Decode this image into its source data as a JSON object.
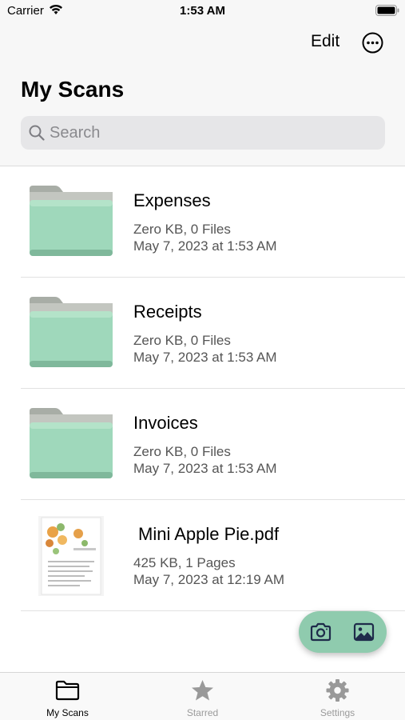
{
  "status_bar": {
    "carrier": "Carrier",
    "time": "1:53 AM"
  },
  "header": {
    "edit_label": "Edit",
    "more_icon": "ellipsis-circle-icon",
    "title": "My Scans"
  },
  "search": {
    "placeholder": "Search",
    "value": ""
  },
  "items": [
    {
      "type": "folder",
      "name": "Expenses",
      "size": "Zero KB, 0 Files",
      "date": "May 7, 2023 at 1:53 AM"
    },
    {
      "type": "folder",
      "name": "Receipts",
      "size": "Zero KB, 0 Files",
      "date": "May 7, 2023 at 1:53 AM"
    },
    {
      "type": "folder",
      "name": "Invoices",
      "size": "Zero KB, 0 Files",
      "date": "May 7, 2023 at 1:53 AM"
    },
    {
      "type": "pdf",
      "name": "Mini Apple Pie.pdf",
      "size": "425 KB, 1 Pages",
      "date": "May 7, 2023 at 12:19 AM"
    }
  ],
  "fab": {
    "camera_icon": "camera-icon",
    "photo_icon": "photo-library-icon",
    "color": "#8fcbae"
  },
  "tabs": [
    {
      "label": "My Scans",
      "icon": "folder-icon",
      "active": true
    },
    {
      "label": "Starred",
      "icon": "star-icon",
      "active": false
    },
    {
      "label": "Settings",
      "icon": "gear-icon",
      "active": false
    }
  ],
  "colors": {
    "folder_green": "#9fd8bb",
    "folder_back": "#a8a8a4",
    "accent_fab": "#8fcbae"
  }
}
